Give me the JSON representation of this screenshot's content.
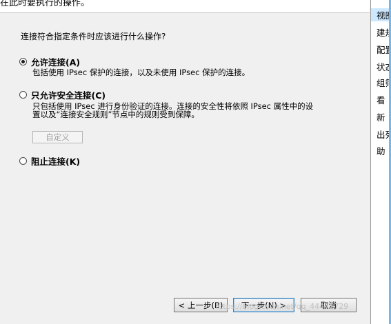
{
  "header": {
    "text": "在此时要执行的操作。"
  },
  "dialog": {
    "question": "连接符合指定条件时应该进行什么操作?",
    "options": [
      {
        "label": "允许连接(A)",
        "checked": true,
        "desc": [
          "包括使用 IPsec 保护的连接，以及未使用 IPsec 保护的连接。"
        ]
      },
      {
        "label": "只允许安全连接(C)",
        "checked": false,
        "desc": [
          "只包括使用 IPsec 进行身份验证的连接。连接的安全性将依照 IPsec 属性中的设",
          "置以及“连接安全规则”节点中的规则受到保障。"
        ]
      },
      {
        "label": "阻止连接(K)",
        "checked": false,
        "desc": []
      }
    ],
    "customize_label": "自定义",
    "buttons": {
      "back": "< 上一步(B)",
      "next": "下一步(N) >",
      "cancel": "取消"
    }
  },
  "right_pane": {
    "items": [
      "视图",
      "建规",
      "配置",
      "状态",
      "组筛",
      "看",
      "新",
      "出列",
      "助"
    ]
  },
  "watermark": "https://blog.csdn.net/qq_44472729",
  "colors": {
    "selection": "#cce8ff",
    "accent": "#79b6e8",
    "disabled_text": "#a0a0a0"
  }
}
